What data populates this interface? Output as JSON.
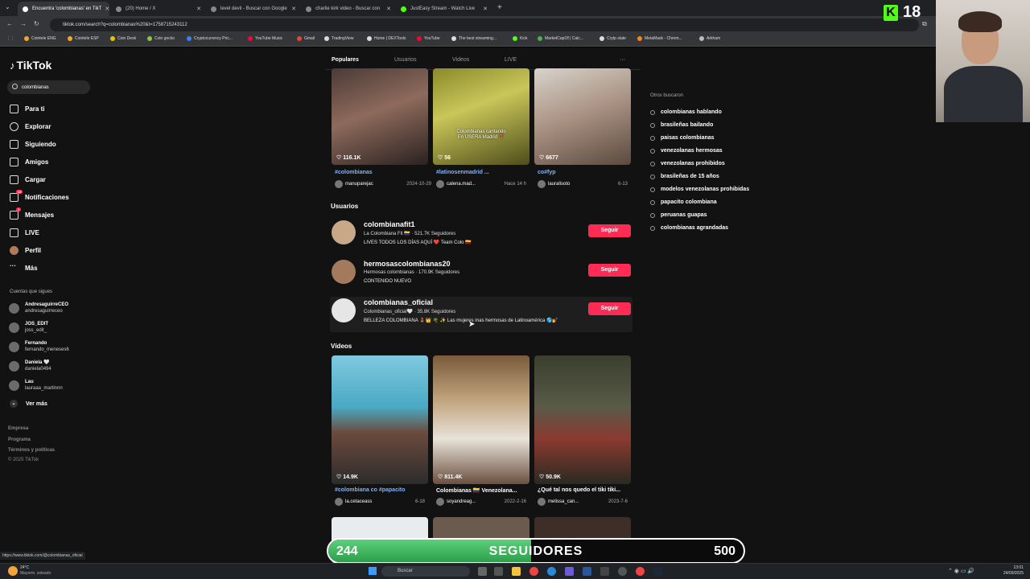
{
  "browser": {
    "tabs": [
      {
        "title": "Encuentra 'colombianas' en TikT"
      },
      {
        "title": "(20) Home / X"
      },
      {
        "title": "level devil - Buscar con Google"
      },
      {
        "title": "charlie kirk video - Buscar con"
      },
      {
        "title": "JustEasy Stream - Watch Live"
      }
    ],
    "url": "tiktok.com/search?q=colombianas%20&t=1758715243112",
    "bookmarks": [
      "Cointele ENG",
      "Cointele ESP",
      "Coin Desk",
      "Coin gecko",
      "Cryptocurrency Pric...",
      "YouTube Music",
      "Gmail",
      "TradingView",
      "Home | DEXTools",
      "YouTube",
      "The best streaming...",
      "Kick",
      "MarketCapOf | Calc...",
      "Crytp slate",
      "MetaMask - Chrom...",
      "Arkham"
    ],
    "status_url": "https://www.tiktok.com/@colombianas_oficial"
  },
  "sidebar": {
    "logo": "TikTok",
    "search_value": "colombianas",
    "nav": [
      {
        "label": "Para ti",
        "icon": "home-icon"
      },
      {
        "label": "Explorar",
        "icon": "compass-icon"
      },
      {
        "label": "Siguiendo",
        "icon": "following-icon"
      },
      {
        "label": "Amigos",
        "icon": "friends-icon"
      },
      {
        "label": "Cargar",
        "icon": "upload-icon"
      },
      {
        "label": "Notificaciones",
        "icon": "bell-icon",
        "badge": "15"
      },
      {
        "label": "Mensajes",
        "icon": "message-icon",
        "badge": "1"
      },
      {
        "label": "LIVE",
        "icon": "live-icon"
      },
      {
        "label": "Perfil",
        "icon": "profile-icon"
      },
      {
        "label": "Más",
        "icon": "more-icon"
      }
    ],
    "following_title": "Cuentas que sigues",
    "following": [
      {
        "name": "AndresaguirreCEO",
        "handle": "andresaguirreceo"
      },
      {
        "name": "JOS_EDIT",
        "handle": "joss_edit_"
      },
      {
        "name": "Fernando",
        "handle": "fernando_meneses6"
      },
      {
        "name": "Daniela 🤍",
        "handle": "daniela0494"
      },
      {
        "name": "Lau",
        "handle": "lauraaa_martinnn"
      }
    ],
    "see_more": "Ver más",
    "footer": [
      "Empresa",
      "Programa",
      "Términos y políticas",
      "© 2025 TikTok"
    ]
  },
  "search_tabs": [
    "Populares",
    "Usuarios",
    "Videos",
    "LIVE"
  ],
  "top_videos": [
    {
      "likes": "116.1K",
      "title": "#colombianas",
      "author": "manuparejac",
      "date": "2024-10-29",
      "caption": ""
    },
    {
      "likes": "56",
      "title": "#latinosenmadrid ...",
      "author": "calena.mad...",
      "date": "Hace 14 h",
      "caption": "Colombianas cantando\nEn USERA Madrid 📍"
    },
    {
      "likes": "6677",
      "title": "co#fyp",
      "author": "lauralisoto",
      "date": "6-13",
      "caption": ""
    }
  ],
  "users_title": "Usuarios",
  "users": [
    {
      "username": "colombianafit1",
      "line2": "La Colombiana Fit 🇨🇴 · 521.7K Seguidores",
      "line3": "LIVES TODOS LOS DÍAS AQUÍ ❤️ Team Colo 🇨🇴",
      "button": "Seguir"
    },
    {
      "username": "hermosascolombianas20",
      "line2": "Hermosas colombianas · 170.9K Seguidores",
      "line3": "CONTENIDO NUEVO",
      "button": "Seguir"
    },
    {
      "username": "colombianas_oficial",
      "line2": "Colombianas_oficial🤍 · 35.8K Seguidores",
      "line3": "BELLEZA COLOMBIANA 💄👑 🌴 ✨ Las mujeres mas hermosas de Latinoamérica 🌎💅",
      "button": "Seguir"
    }
  ],
  "videos_title": "Vídeos",
  "videos": [
    {
      "likes": "14.9K",
      "title": "#colombiana co #papacito",
      "author": "la.cetaceass",
      "date": "6-18"
    },
    {
      "likes": "811.4K",
      "title": "Colombianas 🇨🇴 Venezolana...",
      "author": "soyandreag...",
      "date": "2022-2-16"
    },
    {
      "likes": "50.9K",
      "title": "¿Qué tal nos quedo el tiki tiki...",
      "author": "melissa_can...",
      "date": "2023-7-6"
    }
  ],
  "related": {
    "title": "Otros buscaron",
    "items": [
      "colombianas hablando",
      "brasileñas bailando",
      "paisas colombianas",
      "venezolanas hermosas",
      "venezolanas prohibidos",
      "brasileñas de 15 años",
      "modelos venezolanas prohibidas",
      "papacito colombiana",
      "peruanas guapas",
      "colombianas agrandadas"
    ]
  },
  "overlay": {
    "kick_count": "18",
    "followers_current": "244",
    "followers_label": "SEGUIDORES",
    "followers_goal": "500",
    "followers_progress": 0.488
  },
  "taskbar": {
    "weather_temp": "24°C",
    "weather_desc": "Mayorm. soleado",
    "search_label": "Buscar",
    "time": "13:01",
    "date": "24/09/2025"
  },
  "colors": {
    "accent": "#fe2c55",
    "kick": "#53fc18",
    "bar": "#3fbf5f",
    "hashtag": "#7fb1ff"
  }
}
